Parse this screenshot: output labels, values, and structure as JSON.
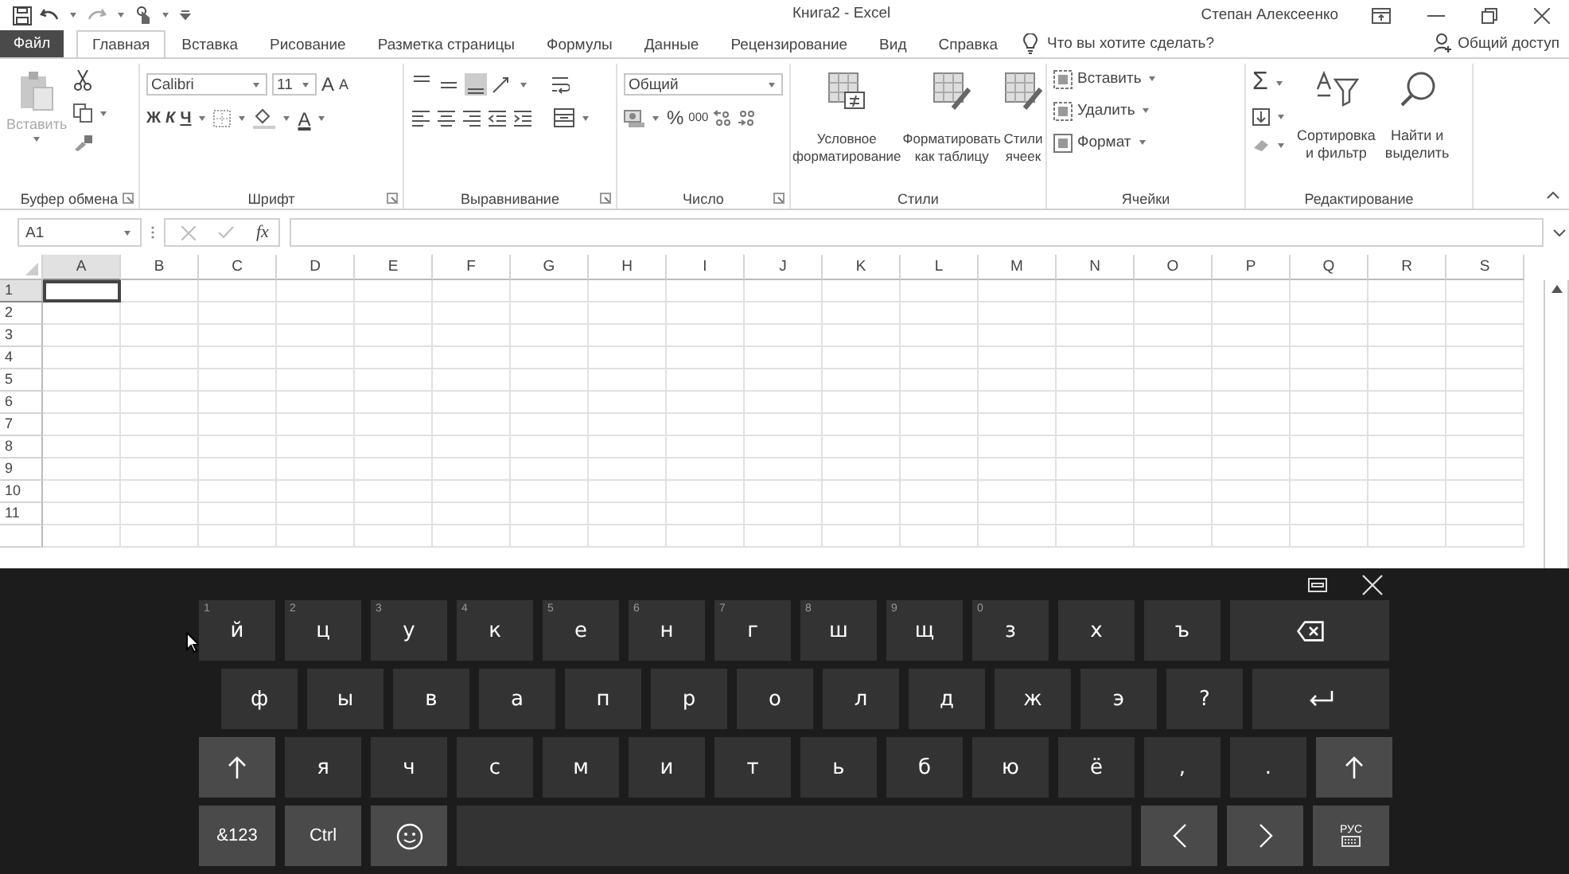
{
  "title_bar": {
    "title": "Книга2 - Excel",
    "user": "Степан Алексеенко"
  },
  "file_tab": "Файл",
  "tabs": [
    {
      "label": "Главная",
      "selected": true
    },
    {
      "label": "Вставка",
      "selected": false
    },
    {
      "label": "Рисование",
      "selected": false
    },
    {
      "label": "Разметка страницы",
      "selected": false
    },
    {
      "label": "Формулы",
      "selected": false
    },
    {
      "label": "Данные",
      "selected": false
    },
    {
      "label": "Рецензирование",
      "selected": false
    },
    {
      "label": "Вид",
      "selected": false
    },
    {
      "label": "Справка",
      "selected": false
    }
  ],
  "tell_me": "Что вы хотите сделать?",
  "share": "Общий доступ",
  "ribbon": {
    "clipboard": {
      "label": "Буфер обмена",
      "paste": "Вставить"
    },
    "font": {
      "label": "Шрифт",
      "font_name": "Calibri",
      "font_size": "11",
      "grow": "A",
      "shrink": "A",
      "bold": "Ж",
      "italic": "К",
      "underline": "Ч",
      "font_color": "A"
    },
    "alignment": {
      "label": "Выравнивание"
    },
    "number": {
      "label": "Число",
      "format": "Общий",
      "percent": "%",
      "thousands": "000"
    },
    "styles": {
      "label": "Стили",
      "buttons": [
        {
          "lines": [
            "Условное",
            "форматирование"
          ]
        },
        {
          "lines": [
            "Форматировать",
            "как таблицу"
          ]
        },
        {
          "lines": [
            "Стили",
            "ячеек"
          ]
        }
      ]
    },
    "cells": {
      "label": "Ячейки",
      "buttons": [
        "Вставить",
        "Удалить",
        "Формат"
      ]
    },
    "editing": {
      "label": "Редактирование",
      "autosum": "Σ",
      "buttons": [
        {
          "lines": [
            "Сортировка",
            "и фильтр"
          ]
        },
        {
          "lines": [
            "Найти и",
            "выделить"
          ]
        }
      ]
    }
  },
  "formula_bar": {
    "name_box": "A1",
    "fx": "fx"
  },
  "grid": {
    "columns": [
      {
        "label": "A",
        "selected": true
      },
      {
        "label": "B",
        "selected": false
      },
      {
        "label": "C",
        "selected": false
      },
      {
        "label": "D",
        "selected": false
      },
      {
        "label": "E",
        "selected": false
      },
      {
        "label": "F",
        "selected": false
      },
      {
        "label": "G",
        "selected": false
      },
      {
        "label": "H",
        "selected": false
      },
      {
        "label": "I",
        "selected": false
      },
      {
        "label": "J",
        "selected": false
      },
      {
        "label": "K",
        "selected": false
      },
      {
        "label": "L",
        "selected": false
      },
      {
        "label": "M",
        "selected": false
      },
      {
        "label": "N",
        "selected": false
      },
      {
        "label": "O",
        "selected": false
      },
      {
        "label": "P",
        "selected": false
      },
      {
        "label": "Q",
        "selected": false
      },
      {
        "label": "R",
        "selected": false
      },
      {
        "label": "S",
        "selected": false
      }
    ],
    "rows": [
      {
        "label": "1",
        "selected": true
      },
      {
        "label": "2",
        "selected": false
      },
      {
        "label": "3",
        "selected": false
      },
      {
        "label": "4",
        "selected": false
      },
      {
        "label": "5",
        "selected": false
      },
      {
        "label": "6",
        "selected": false
      },
      {
        "label": "7",
        "selected": false
      },
      {
        "label": "8",
        "selected": false
      },
      {
        "label": "9",
        "selected": false
      },
      {
        "label": "10",
        "selected": false
      },
      {
        "label": "11",
        "selected": false
      }
    ]
  },
  "keyboard": {
    "rows": [
      [
        {
          "kind": "letter",
          "label": "й",
          "hint": "1"
        },
        {
          "kind": "letter",
          "label": "ц",
          "hint": "2"
        },
        {
          "kind": "letter",
          "label": "у",
          "hint": "3"
        },
        {
          "kind": "letter",
          "label": "к",
          "hint": "4"
        },
        {
          "kind": "letter",
          "label": "е",
          "hint": "5"
        },
        {
          "kind": "letter",
          "label": "н",
          "hint": "6"
        },
        {
          "kind": "letter",
          "label": "г",
          "hint": "7"
        },
        {
          "kind": "letter",
          "label": "ш",
          "hint": "8"
        },
        {
          "kind": "letter",
          "label": "щ",
          "hint": "9"
        },
        {
          "kind": "letter",
          "label": "з",
          "hint": "0"
        },
        {
          "kind": "letter",
          "label": "х"
        },
        {
          "kind": "letter",
          "label": "ъ"
        },
        {
          "kind": "backspace"
        }
      ],
      [
        {
          "kind": "letter",
          "label": "ф"
        },
        {
          "kind": "letter",
          "label": "ы"
        },
        {
          "kind": "letter",
          "label": "в"
        },
        {
          "kind": "letter",
          "label": "а"
        },
        {
          "kind": "letter",
          "label": "п"
        },
        {
          "kind": "letter",
          "label": "р"
        },
        {
          "kind": "letter",
          "label": "о"
        },
        {
          "kind": "letter",
          "label": "л"
        },
        {
          "kind": "letter",
          "label": "д"
        },
        {
          "kind": "letter",
          "label": "ж"
        },
        {
          "kind": "letter",
          "label": "э"
        },
        {
          "kind": "letter",
          "label": "?"
        },
        {
          "kind": "enter"
        }
      ],
      [
        {
          "kind": "shift"
        },
        {
          "kind": "letter",
          "label": "я"
        },
        {
          "kind": "letter",
          "label": "ч"
        },
        {
          "kind": "letter",
          "label": "с"
        },
        {
          "kind": "letter",
          "label": "м"
        },
        {
          "kind": "letter",
          "label": "и"
        },
        {
          "kind": "letter",
          "label": "т"
        },
        {
          "kind": "letter",
          "label": "ь"
        },
        {
          "kind": "letter",
          "label": "б"
        },
        {
          "kind": "letter",
          "label": "ю"
        },
        {
          "kind": "letter",
          "label": "ё"
        },
        {
          "kind": "letter",
          "label": ","
        },
        {
          "kind": "letter",
          "label": "."
        },
        {
          "kind": "shift"
        }
      ],
      [
        {
          "kind": "function",
          "label": "&123"
        },
        {
          "kind": "function",
          "label": "Ctrl"
        },
        {
          "kind": "emoji"
        },
        {
          "kind": "space"
        },
        {
          "kind": "left"
        },
        {
          "kind": "right"
        },
        {
          "kind": "language",
          "label": "РУС"
        }
      ]
    ]
  }
}
